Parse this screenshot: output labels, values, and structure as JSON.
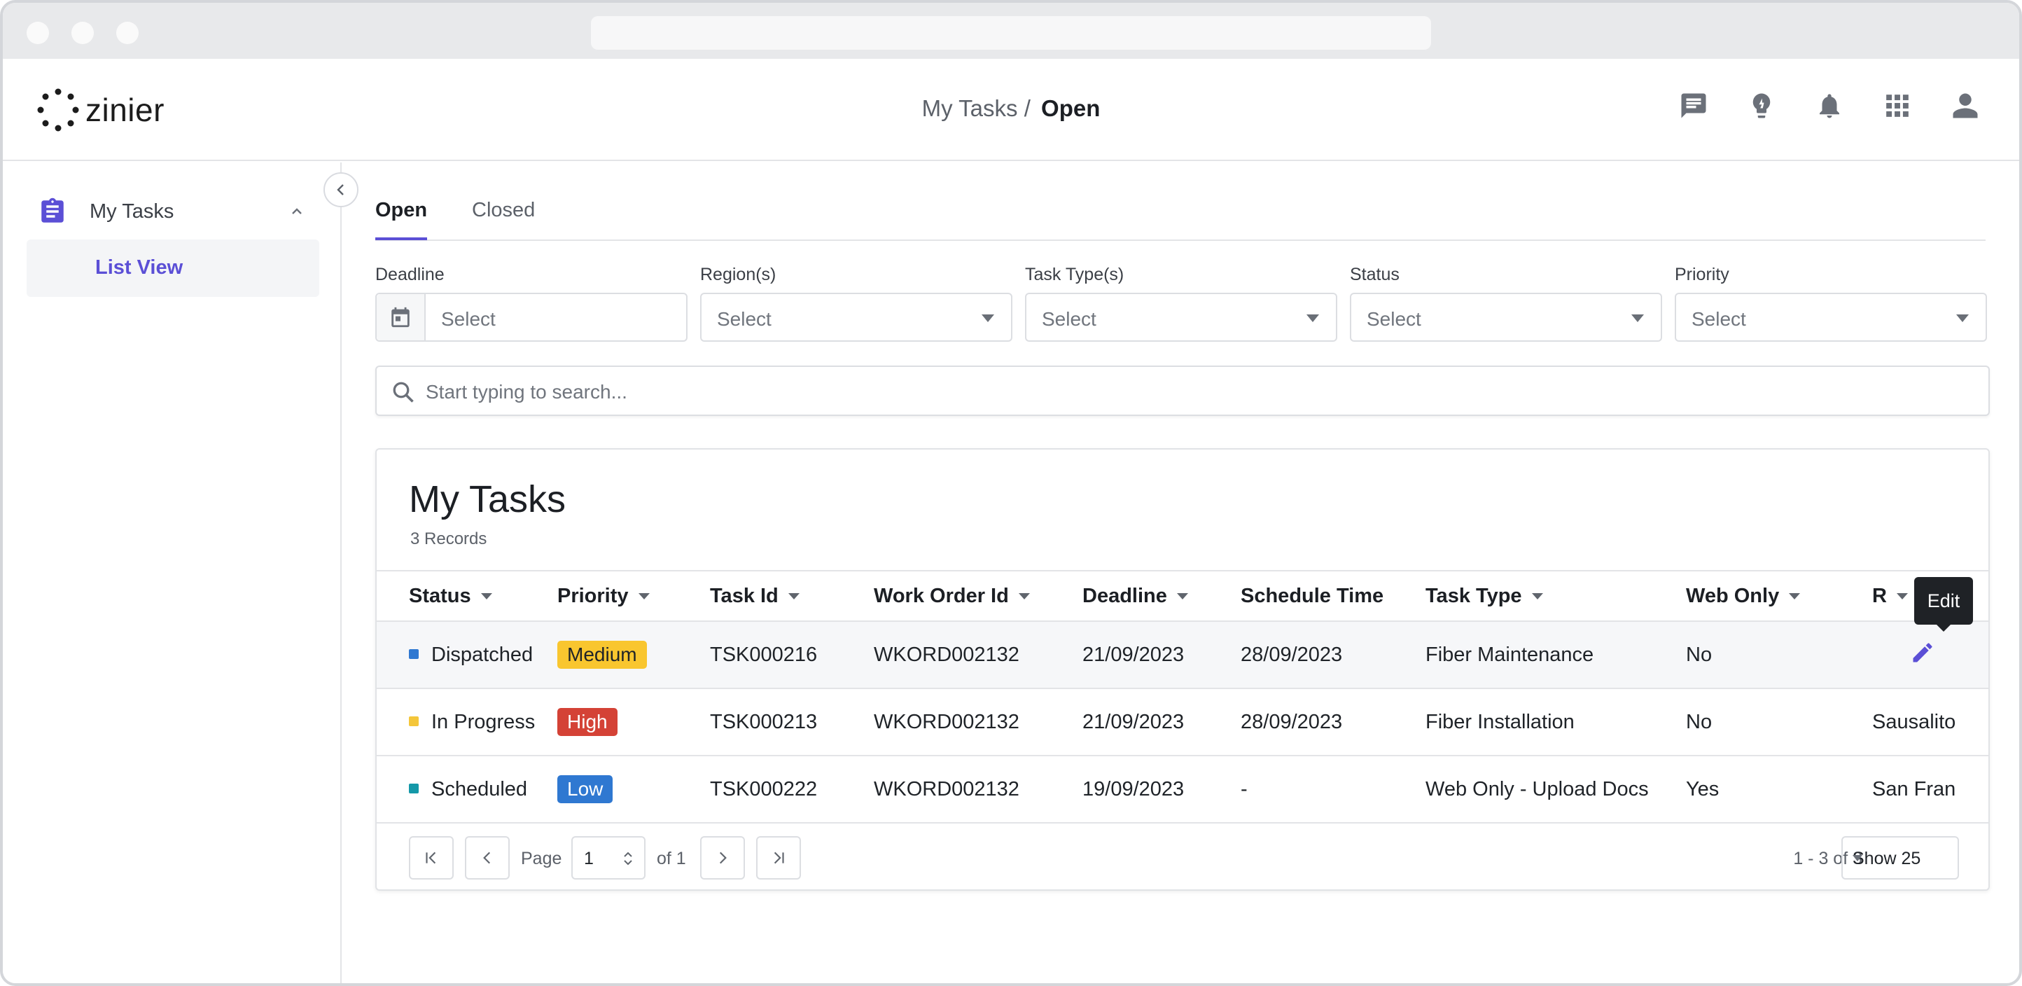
{
  "app": {
    "logo_text": "zinier",
    "breadcrumb_root": "My Tasks /",
    "breadcrumb_current": "Open"
  },
  "header_icons": [
    "chat-icon",
    "lightbulb-icon",
    "bell-icon",
    "apps-grid-icon",
    "user-icon"
  ],
  "sidebar": {
    "group_label": "My Tasks",
    "items": [
      {
        "label": "List View"
      }
    ]
  },
  "tabs": [
    {
      "label": "Open",
      "active": true
    },
    {
      "label": "Closed",
      "active": false
    }
  ],
  "filters": [
    {
      "label": "Deadline",
      "placeholder": "Select"
    },
    {
      "label": "Region(s)",
      "placeholder": "Select"
    },
    {
      "label": "Task Type(s)",
      "placeholder": "Select"
    },
    {
      "label": "Status",
      "placeholder": "Select"
    },
    {
      "label": "Priority",
      "placeholder": "Select"
    }
  ],
  "search": {
    "placeholder": "Start typing to search..."
  },
  "card": {
    "title": "My Tasks",
    "record_count": "3 Records"
  },
  "table": {
    "columns": [
      "Status",
      "Priority",
      "Task Id",
      "Work Order Id",
      "Deadline",
      "Schedule Time",
      "Task Type",
      "Web Only",
      "R"
    ],
    "rows": [
      {
        "status": "Dispatched",
        "status_color": "#2f78d1",
        "priority": "Medium",
        "priority_bg": "#f9c62f",
        "priority_fg": "#1f2328",
        "task_id": "TSK000216",
        "work_order_id": "WKORD002132",
        "deadline": "21/09/2023",
        "schedule_time": "28/09/2023",
        "task_type": "Fiber Maintenance",
        "web_only": "No",
        "region": ""
      },
      {
        "status": "In Progress",
        "status_color": "#f4c63a",
        "priority": "High",
        "priority_bg": "#d44236",
        "priority_fg": "#ffffff",
        "task_id": "TSK000213",
        "work_order_id": "WKORD002132",
        "deadline": "21/09/2023",
        "schedule_time": "28/09/2023",
        "task_type": "Fiber Installation",
        "web_only": "No",
        "region": "Sausalito"
      },
      {
        "status": "Scheduled",
        "status_color": "#1498a8",
        "priority": "Low",
        "priority_bg": "#2f78d1",
        "priority_fg": "#ffffff",
        "task_id": "TSK000222",
        "work_order_id": "WKORD002132",
        "deadline": "19/09/2023",
        "schedule_time": "-",
        "task_type": "Web Only - Upload Docs",
        "web_only": "Yes",
        "region": "San Fran"
      }
    ]
  },
  "tooltip": {
    "text": "Edit"
  },
  "pagination": {
    "page_label": "Page",
    "current_page": "1",
    "of_label": "of 1",
    "range_text": "1 - 3 of 3",
    "page_size": "Show 25"
  },
  "colors": {
    "accent": "#5b4fd6"
  }
}
